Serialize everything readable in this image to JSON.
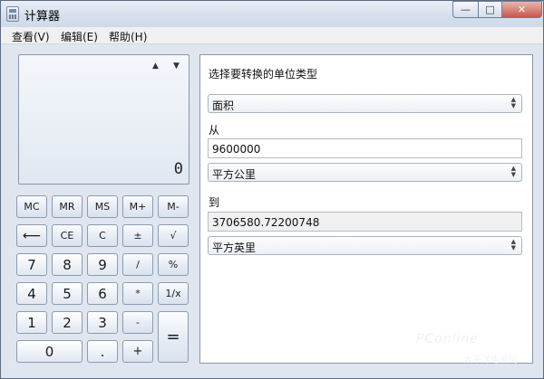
{
  "window": {
    "title": "计算器",
    "min_glyph": "—",
    "max_glyph": "□",
    "close_glyph": "✕"
  },
  "menu": {
    "view": "查看(V)",
    "edit": "编辑(E)",
    "help": "帮助(H)"
  },
  "display": {
    "value": "0",
    "history_up": "▲",
    "history_down": "▼"
  },
  "keys": {
    "mc": "MC",
    "mr": "MR",
    "ms": "MS",
    "mplus": "M+",
    "mminus": "M-",
    "backspace": "⟵",
    "ce": "CE",
    "c": "C",
    "plusminus": "±",
    "sqrt": "√",
    "n7": "7",
    "n8": "8",
    "n9": "9",
    "divide": "/",
    "percent": "%",
    "n4": "4",
    "n5": "5",
    "n6": "6",
    "multiply": "*",
    "reciprocal": "1/x",
    "n1": "1",
    "n2": "2",
    "n3": "3",
    "minus": "-",
    "equals": "=",
    "n0": "0",
    "decimal": ".",
    "plus": "+"
  },
  "converter": {
    "type_label": "选择要转换的单位类型",
    "type_value": "面积",
    "from_label": "从",
    "from_value": "9600000",
    "from_unit": "平方公里",
    "to_label": "到",
    "to_value": "3706580.72200748",
    "to_unit": "平方英里"
  },
  "watermark": {
    "main": "PConline",
    "sub": "太平洋电脑网"
  }
}
